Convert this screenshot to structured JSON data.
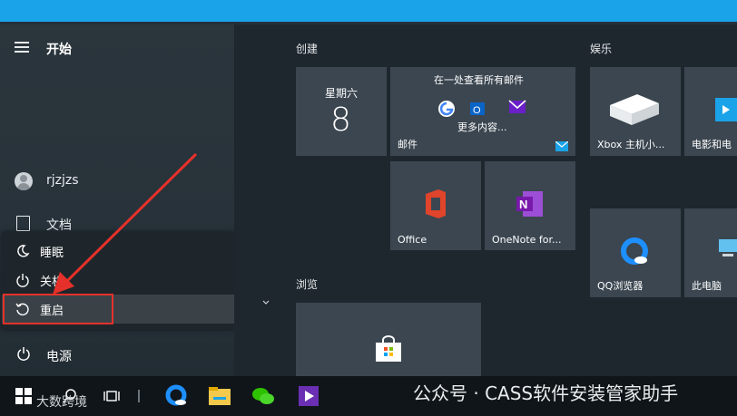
{
  "start": {
    "title": "开始"
  },
  "user": {
    "name": "rjzjzs"
  },
  "left": {
    "documents": "文档",
    "power": "电源"
  },
  "power_menu": {
    "sleep": "睡眠",
    "shutdown": "关机",
    "restart": "重启"
  },
  "groups": {
    "create": "创建",
    "entertainment": "娱乐",
    "browse": "浏览"
  },
  "tiles": {
    "calendar": {
      "weekday": "星期六",
      "day": "8"
    },
    "mail": {
      "header": "在一处查看所有邮件",
      "more": "更多内容...",
      "label": "邮件"
    },
    "office": {
      "label": "Office"
    },
    "onenote": {
      "label": "OneNote for..."
    },
    "xbox": {
      "label": "Xbox 主机小..."
    },
    "movies": {
      "label": "电影和电"
    },
    "qqbrowser": {
      "label": "QQ浏览器"
    },
    "thispc": {
      "label": "此电脑"
    }
  },
  "watermark": {
    "text": "公众号 · CASS软件安装管家助手",
    "left": "大数跨境"
  },
  "colors": {
    "accent": "#1aa3e8",
    "tile": "#3b4650",
    "highlight": "#e5312a"
  }
}
